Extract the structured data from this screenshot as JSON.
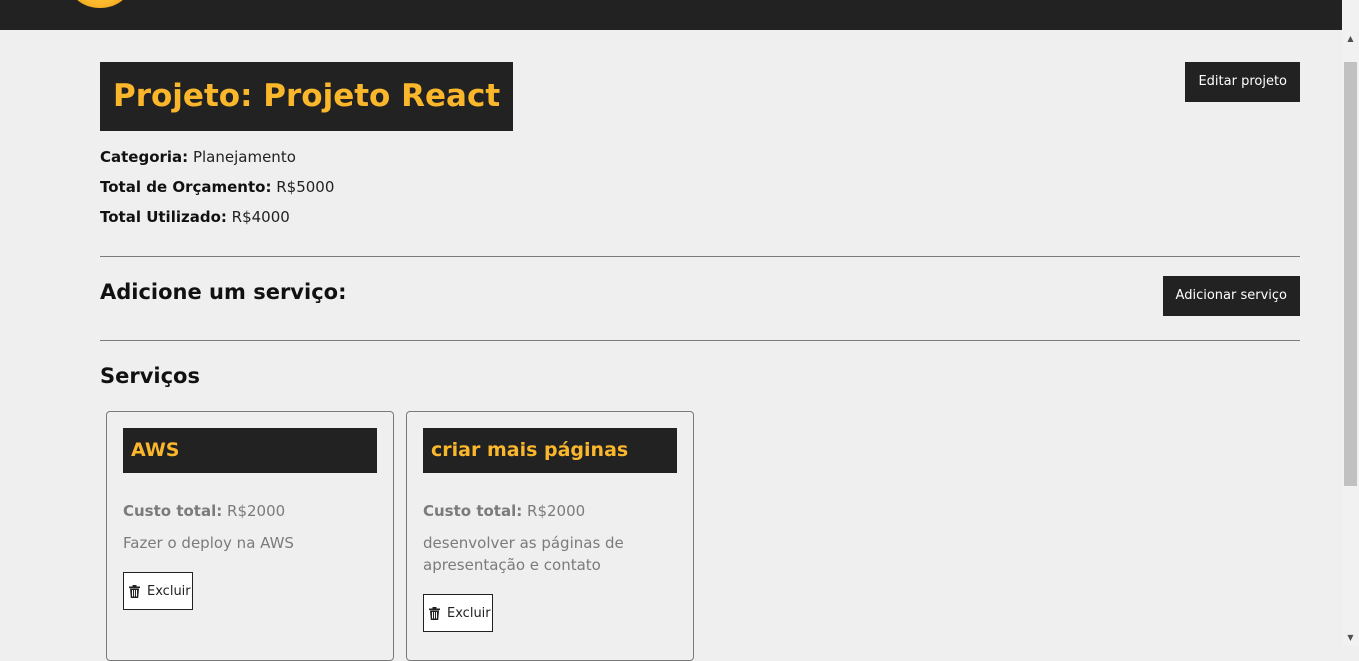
{
  "project": {
    "title": "Projeto: Projeto React",
    "edit_label": "Editar projeto",
    "category_label": "Categoria:",
    "category_value": "Planejamento",
    "budget_label": "Total de Orçamento:",
    "budget_value": "R$5000",
    "used_label": "Total Utilizado:",
    "used_value": "R$4000"
  },
  "add_service": {
    "heading": "Adicione um serviço:",
    "button_label": "Adicionar serviço"
  },
  "services": {
    "heading": "Serviços",
    "items": [
      {
        "name": "AWS",
        "cost_label": "Custo total:",
        "cost_value": "R$2000",
        "description": "Fazer o deploy na AWS",
        "delete_label": "Excluir"
      },
      {
        "name": "criar mais páginas",
        "cost_label": "Custo total:",
        "cost_value": "R$2000",
        "description": "desenvolver as páginas de apresentação e contato",
        "delete_label": "Excluir"
      }
    ]
  },
  "icons": {
    "logo": "coins-logo-icon",
    "delete": "trash-icon"
  },
  "colors": {
    "accent": "#fbb72b",
    "dark": "#222222",
    "background": "#efefef",
    "muted_text": "#7b7b7b"
  }
}
